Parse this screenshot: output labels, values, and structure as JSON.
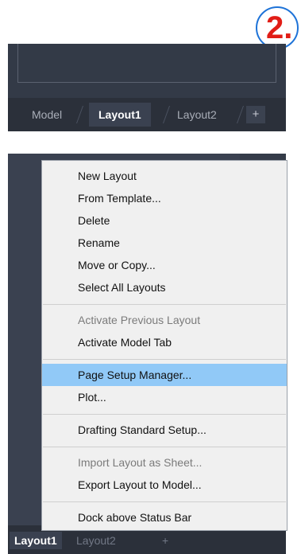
{
  "step_badge": {
    "text": "2."
  },
  "top_tabs": {
    "model": "Model",
    "layout1": "Layout1",
    "layout2": "Layout2",
    "plus": "+"
  },
  "bottom_tabs": {
    "layout1": "Layout1",
    "layout2": "Layout2",
    "plus": "+"
  },
  "context_menu": {
    "items": [
      {
        "label": "New Layout",
        "enabled": true
      },
      {
        "label": "From Template...",
        "enabled": true
      },
      {
        "label": "Delete",
        "enabled": true
      },
      {
        "label": "Rename",
        "enabled": true
      },
      {
        "label": "Move or Copy...",
        "enabled": true
      },
      {
        "label": "Select All Layouts",
        "enabled": true
      },
      {
        "label": "Activate Previous Layout",
        "enabled": false
      },
      {
        "label": "Activate Model Tab",
        "enabled": true
      },
      {
        "label": "Page Setup Manager...",
        "enabled": true,
        "highlighted": true
      },
      {
        "label": "Plot...",
        "enabled": true
      },
      {
        "label": "Drafting Standard Setup...",
        "enabled": true
      },
      {
        "label": "Import Layout as Sheet...",
        "enabled": false
      },
      {
        "label": "Export Layout to Model...",
        "enabled": true
      },
      {
        "label": "Dock above Status Bar",
        "enabled": true
      }
    ]
  },
  "colors": {
    "badge_text": "#e11d16",
    "badge_ring": "#1e73d8",
    "panel_bg": "#3a4150",
    "tabbar_bg": "#2b303a",
    "menu_bg": "#f0f0f0",
    "menu_highlight": "#91c9f7"
  }
}
